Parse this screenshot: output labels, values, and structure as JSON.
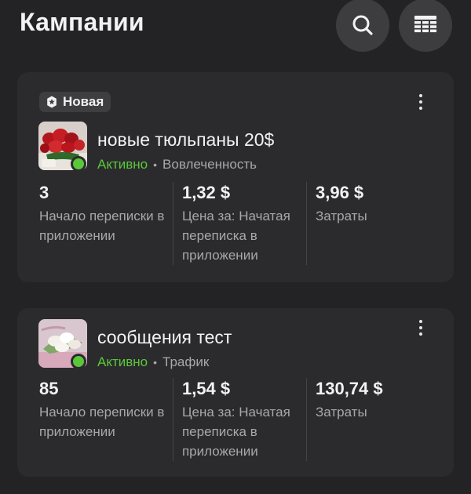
{
  "header": {
    "title": "Кампании",
    "search_icon": "search-icon",
    "table_icon": "table-columns-icon"
  },
  "colors": {
    "background": "#232325",
    "card": "#2b2b2d",
    "active_green": "#5ac83a",
    "secondary_text": "#a8a8ab"
  },
  "campaigns": [
    {
      "badge": "Новая",
      "badge_icon": "star-badge-icon",
      "name": "новые тюльпаны 20$",
      "thumbnail": "red-tulips-image",
      "status": "Активно",
      "separator": "•",
      "objective": "Вовлеченность",
      "metrics": [
        {
          "value": "3",
          "label": "Начало переписки в приложении"
        },
        {
          "value": "1,32 $",
          "label": "Цена за: Начатая переписка в приложении"
        },
        {
          "value": "3,96 $",
          "label": "Затраты"
        }
      ]
    },
    {
      "name": "сообщения тест",
      "thumbnail": "white-tulips-image",
      "status": "Активно",
      "separator": "•",
      "objective": "Трафик",
      "metrics": [
        {
          "value": "85",
          "label": "Начало переписки в приложении"
        },
        {
          "value": "1,54 $",
          "label": "Цена за: Начатая переписка в приложении"
        },
        {
          "value": "130,74 $",
          "label": "Затраты"
        }
      ]
    }
  ]
}
